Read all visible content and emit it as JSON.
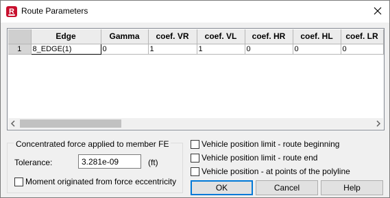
{
  "window": {
    "title": "Route Parameters",
    "app_icon_letter": "R",
    "close_icon": "close-icon"
  },
  "grid": {
    "corner": "",
    "columns": [
      "Edge",
      "Gamma",
      "coef. VR",
      "coef. VL",
      "coef. HR",
      "coef. HL",
      "coef. LR"
    ],
    "rows": [
      {
        "row_number": "1",
        "cells": [
          "8_EDGE(1)",
          "0",
          "1",
          "1",
          "0",
          "0",
          "0"
        ]
      }
    ],
    "scroll_left_icon": "chevron-left-icon",
    "scroll_right_icon": "chevron-right-icon"
  },
  "concentrated_force": {
    "group_title": "Concentrated force applied to member  FE",
    "tolerance_label": "Tolerance:",
    "tolerance_value": "3.281e-09",
    "tolerance_unit": "(ft)",
    "moment_checkbox_label": "Moment originated from force eccentricity",
    "moment_checked": false
  },
  "vehicle_options": [
    {
      "label": "Vehicle position limit - route beginning",
      "checked": false
    },
    {
      "label": "Vehicle position limit - route end",
      "checked": false
    },
    {
      "label": "Vehicle position - at points of the polyline",
      "checked": false
    }
  ],
  "buttons": {
    "ok": "OK",
    "cancel": "Cancel",
    "help": "Help"
  },
  "colors": {
    "app_icon": "#c8102e",
    "default_button_border": "#0078d7"
  }
}
